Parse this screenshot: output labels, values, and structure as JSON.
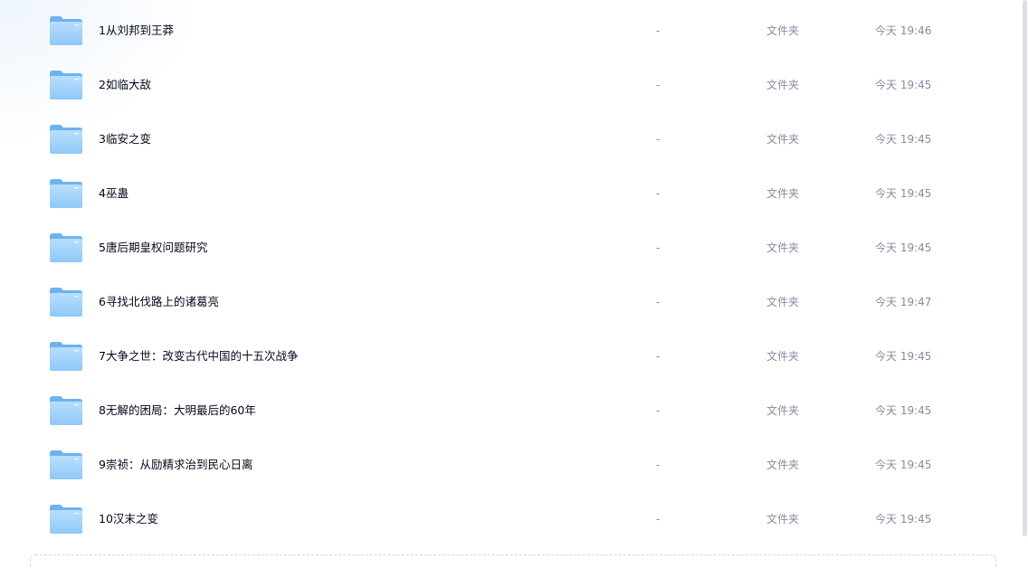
{
  "file_list": {
    "items": [
      {
        "name": "1从刘邦到王莽",
        "size": "-",
        "type": "文件夹",
        "modified": "今天 19:46"
      },
      {
        "name": "2如临大敌",
        "size": "-",
        "type": "文件夹",
        "modified": "今天 19:45"
      },
      {
        "name": "3临安之变",
        "size": "-",
        "type": "文件夹",
        "modified": "今天 19:45"
      },
      {
        "name": "4巫蛊",
        "size": "-",
        "type": "文件夹",
        "modified": "今天 19:45"
      },
      {
        "name": "5唐后期皇权问题研究",
        "size": "-",
        "type": "文件夹",
        "modified": "今天 19:45"
      },
      {
        "name": "6寻找北伐路上的诸葛亮",
        "size": "-",
        "type": "文件夹",
        "modified": "今天 19:47"
      },
      {
        "name": "7大争之世：改变古代中国的十五次战争",
        "size": "-",
        "type": "文件夹",
        "modified": "今天 19:45"
      },
      {
        "name": "8无解的困局：大明最后的60年",
        "size": "-",
        "type": "文件夹",
        "modified": "今天 19:45"
      },
      {
        "name": "9崇祯：从励精求治到民心日离",
        "size": "-",
        "type": "文件夹",
        "modified": "今天 19:45"
      },
      {
        "name": "10汉末之变",
        "size": "-",
        "type": "文件夹",
        "modified": "今天 19:45"
      }
    ]
  },
  "icons": {
    "folder": "folder-icon"
  },
  "colors": {
    "folder_light": "#a9d6fb",
    "folder_dark": "#6fb2ef",
    "name_text": "#03081a",
    "meta_text": "#878c9c"
  }
}
